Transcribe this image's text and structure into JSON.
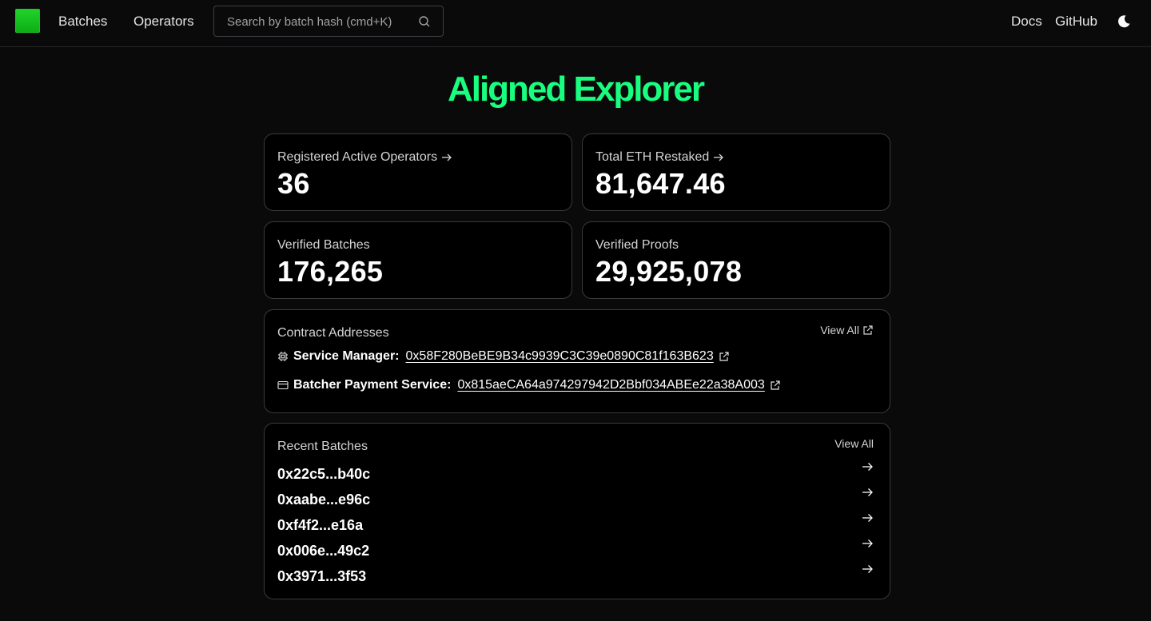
{
  "nav": {
    "links": [
      "Batches",
      "Operators"
    ],
    "search_placeholder": "Search by batch hash (cmd+K)",
    "right_links": [
      "Docs",
      "GitHub"
    ]
  },
  "hero": {
    "title": "Aligned Explorer"
  },
  "stats": [
    {
      "label": "Registered Active Operators",
      "value": "36",
      "has_arrow": true
    },
    {
      "label": "Total ETH Restaked",
      "value": "81,647.46",
      "has_arrow": true
    },
    {
      "label": "Verified Batches",
      "value": "176,265",
      "has_arrow": false
    },
    {
      "label": "Verified Proofs",
      "value": "29,925,078",
      "has_arrow": false
    }
  ],
  "contracts": {
    "title": "Contract Addresses",
    "view_all": "View All",
    "items": [
      {
        "label": "Service Manager:",
        "address": "0x58F280BeBE9B34c9939C3C39e0890C81f163B623",
        "icon": "cpu-icon"
      },
      {
        "label": "Batcher Payment Service:",
        "address": "0x815aeCA64a974297942D2Bbf034ABEe22a38A003",
        "icon": "wallet-icon"
      }
    ]
  },
  "recent_batches": {
    "title": "Recent Batches",
    "view_all": "View All",
    "items": [
      "0x22c5...b40c",
      "0xaabe...e96c",
      "0xf4f2...e16a",
      "0x006e...49c2",
      "0x3971...3f53"
    ]
  },
  "colors": {
    "accent": "#18ff7f",
    "logo": "#16c21e",
    "background": "#0a0a0a",
    "card_border": "#3a3a3a"
  }
}
